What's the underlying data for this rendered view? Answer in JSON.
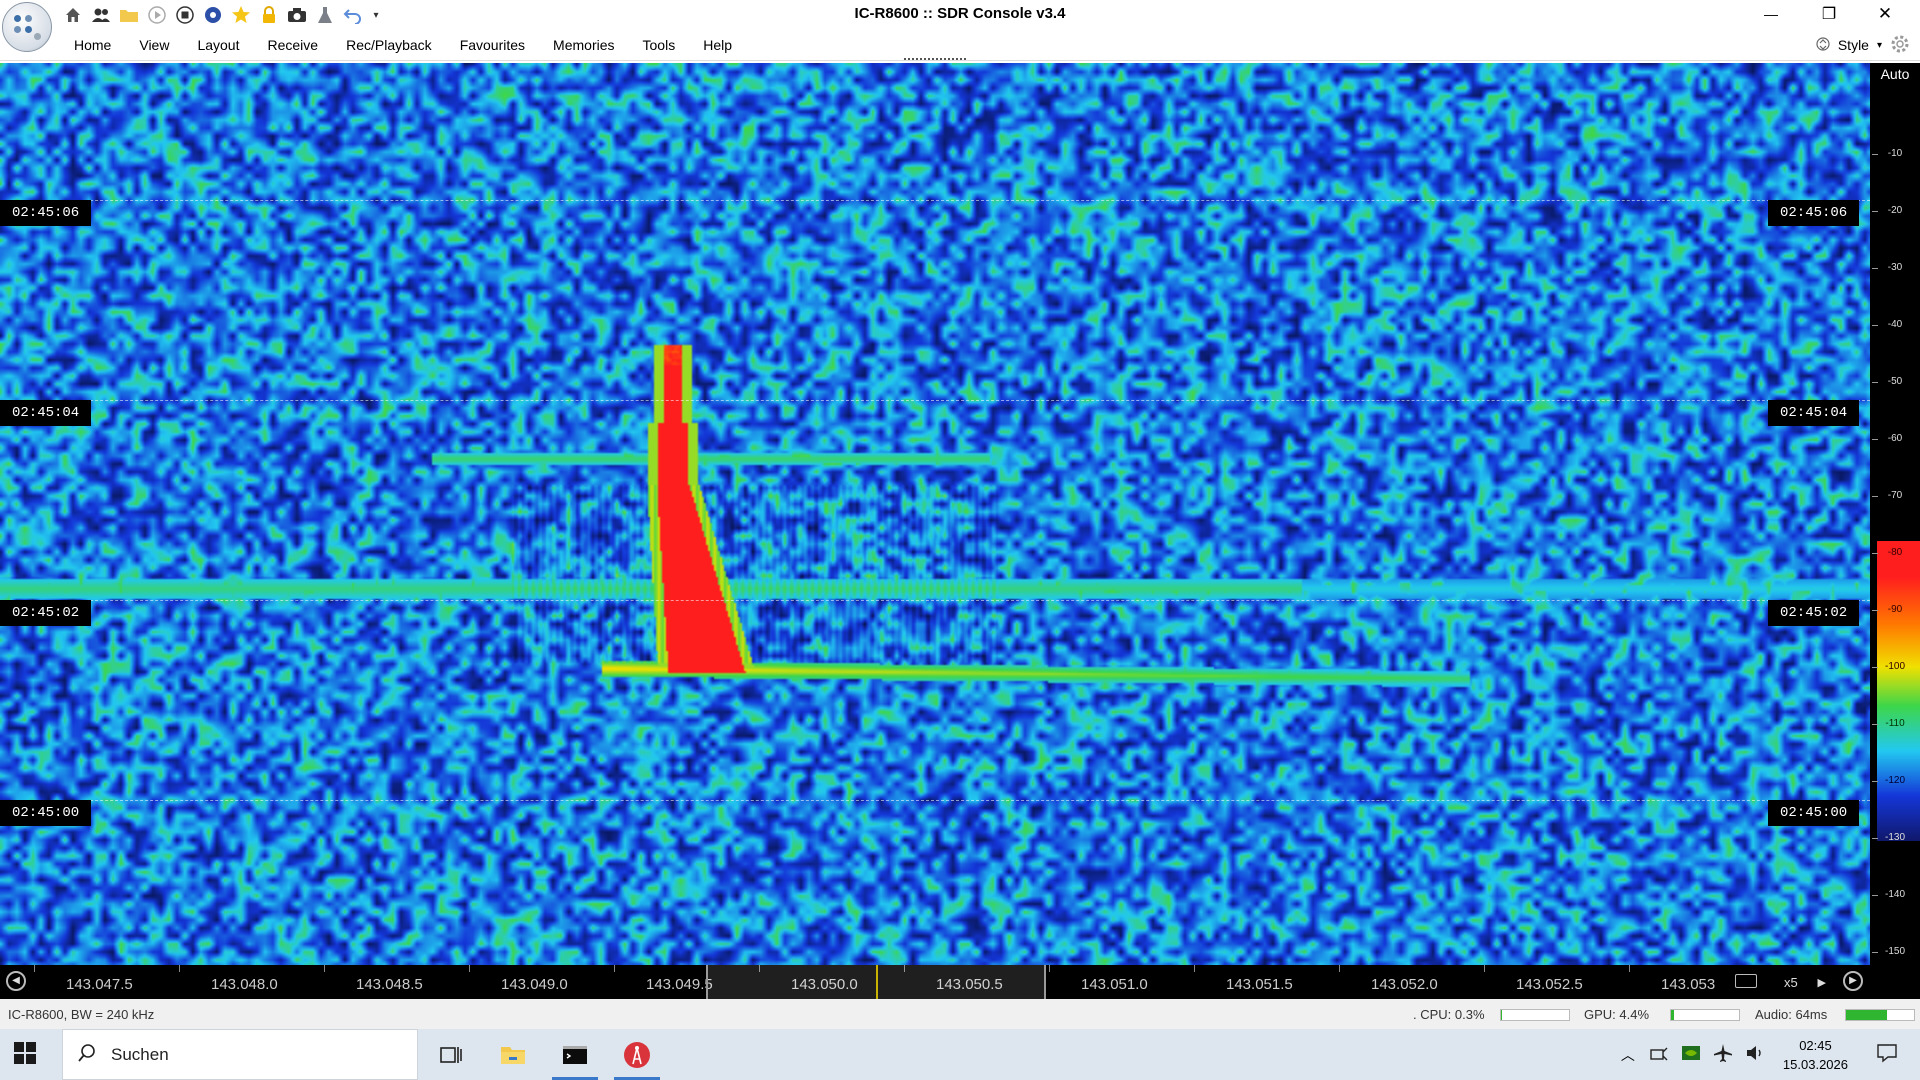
{
  "window": {
    "title": "IC-R8600 :: SDR Console v3.4",
    "minimize_glyph": "—",
    "maximize_glyph": "❐",
    "close_glyph": "✕"
  },
  "quick_access": {
    "icons": [
      "home-icon",
      "users-icon",
      "folder-icon",
      "play-icon",
      "stop-icon",
      "compass-icon",
      "star-icon",
      "lock-icon",
      "camera-icon",
      "flask-icon",
      "undo-icon",
      "dropdown-arrow-icon"
    ]
  },
  "menu": {
    "items": [
      "Home",
      "View",
      "Layout",
      "Receive",
      "Rec/Playback",
      "Favourites",
      "Memories",
      "Tools",
      "Help"
    ],
    "style_label": "Style"
  },
  "waterfall": {
    "time_labels": [
      "02:45:06",
      "02:45:04",
      "02:45:02",
      "02:45:00"
    ],
    "colors": {
      "low": "#000000",
      "mid": "#1436d8",
      "cyan": "#22c8f0",
      "green": "#3dd64a",
      "yellow": "#f0e000",
      "red": "#ff1e1e"
    }
  },
  "scale": {
    "mode_label": "Auto",
    "ticks": [
      "-10",
      "-20",
      "-30",
      "-40",
      "-50",
      "-60",
      "-70",
      "-80",
      "-90",
      "-100",
      "-110",
      "-120",
      "-130",
      "-140",
      "-150"
    ]
  },
  "frequency_axis": {
    "ticks": [
      "143.047.5",
      "143.048.0",
      "143.048.5",
      "143.049.0",
      "143.049.5",
      "143.050.0",
      "143.050.5",
      "143.051.0",
      "143.051.5",
      "143.052.0",
      "143.052.5",
      "143.053"
    ],
    "zoom_label": "x5"
  },
  "status": {
    "receiver": "IC-R8600, BW = 240 kHz",
    "cpu": ". CPU: 0.3%",
    "cpu_level": 0.003,
    "gpu": "GPU: 4.4%",
    "gpu_level": 0.044,
    "audio": "Audio: 64ms",
    "audio_level": 0.6
  },
  "taskbar": {
    "search_placeholder": "Suchen",
    "time": "02:45",
    "date": "15.03.2026",
    "accent": "#3a78c9"
  }
}
